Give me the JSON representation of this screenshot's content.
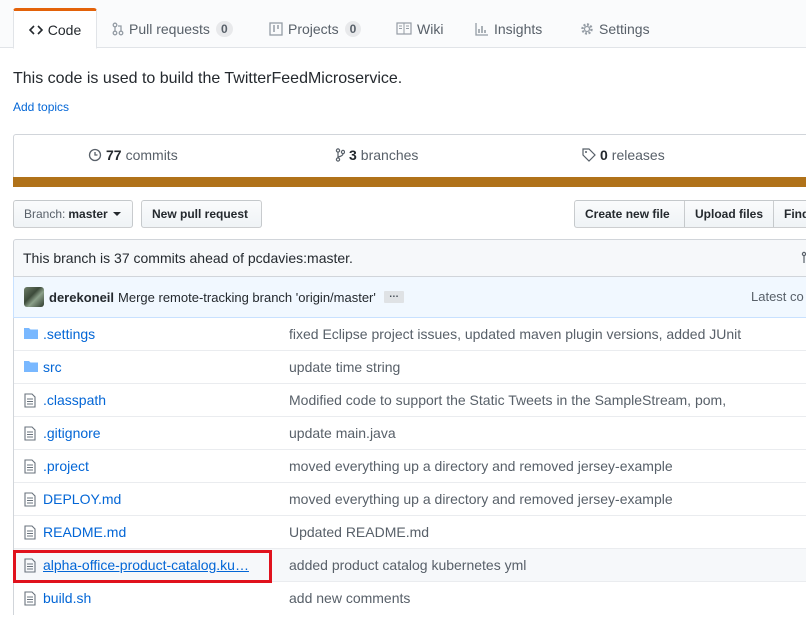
{
  "tabs": [
    {
      "label": "Code",
      "icon": "code-icon"
    },
    {
      "label": "Pull requests",
      "count": "0",
      "icon": "pull-request-icon"
    },
    {
      "label": "Projects",
      "count": "0",
      "icon": "project-icon"
    },
    {
      "label": "Wiki",
      "icon": "book-icon"
    },
    {
      "label": "Insights",
      "icon": "graph-icon"
    },
    {
      "label": "Settings",
      "icon": "gear-icon"
    }
  ],
  "repo": {
    "description": "This code is used to build the TwitterFeedMicroservice.",
    "add_topics": "Add topics"
  },
  "summary": {
    "commits_count": "77",
    "commits_label": "commits",
    "branches_count": "3",
    "branches_label": "branches",
    "releases_count": "0",
    "releases_label": "releases",
    "language_color": "#b07219"
  },
  "toolbar": {
    "branch_prefix": "Branch:",
    "branch_name": "master",
    "new_pull_request": "New pull request",
    "create_new_file": "Create new file",
    "upload_files": "Upload files",
    "find_file": "Find"
  },
  "branch_info": {
    "text": "This branch is 37 commits ahead of pcdavies:master."
  },
  "latest_commit": {
    "author": "derekoneil",
    "message": "Merge remote-tracking branch 'origin/master'",
    "ellipsis": "…",
    "latest_label": "Latest co"
  },
  "files": [
    {
      "name": ".settings",
      "type": "directory",
      "message": "fixed Eclipse project issues, updated maven plugin versions, added JUnit"
    },
    {
      "name": "src",
      "type": "directory",
      "message": "update time string"
    },
    {
      "name": ".classpath",
      "type": "file",
      "message": "Modified code to support the Static Tweets in the SampleStream, pom,"
    },
    {
      "name": ".gitignore",
      "type": "file",
      "message": "update main.java"
    },
    {
      "name": ".project",
      "type": "file",
      "message": "moved everything up a directory and removed jersey-example"
    },
    {
      "name": "DEPLOY.md",
      "type": "file",
      "message": "moved everything up a directory and removed jersey-example"
    },
    {
      "name": "README.md",
      "type": "file",
      "message": "Updated README.md"
    },
    {
      "name": "alpha-office-product-catalog.ku…",
      "type": "file",
      "message": "added product catalog kubernetes yml"
    },
    {
      "name": "build.sh",
      "type": "file",
      "message": "add new comments"
    }
  ],
  "colors": {
    "link": "#0366d6",
    "highlight_border": "#e0121d",
    "tab_accent": "#e36209"
  }
}
